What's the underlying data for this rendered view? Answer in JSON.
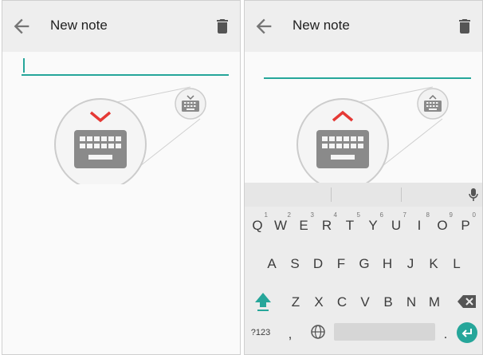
{
  "screens": [
    {
      "title": "New note",
      "keyboard_visible": false,
      "indicator": "chevron-down"
    },
    {
      "title": "New note",
      "keyboard_visible": true,
      "indicator": "chevron-up"
    }
  ],
  "keyboard": {
    "row1": [
      {
        "label": "Q",
        "hint": "1"
      },
      {
        "label": "W",
        "hint": "2"
      },
      {
        "label": "E",
        "hint": "3"
      },
      {
        "label": "R",
        "hint": "4"
      },
      {
        "label": "T",
        "hint": "5"
      },
      {
        "label": "Y",
        "hint": "6"
      },
      {
        "label": "U",
        "hint": "7"
      },
      {
        "label": "I",
        "hint": "8"
      },
      {
        "label": "O",
        "hint": "9"
      },
      {
        "label": "P",
        "hint": "0"
      }
    ],
    "row2": [
      "A",
      "S",
      "D",
      "F",
      "G",
      "H",
      "J",
      "K",
      "L"
    ],
    "row3": [
      "Z",
      "X",
      "C",
      "V",
      "B",
      "N",
      "M"
    ],
    "symbols_label": "?123",
    "comma_label": ",",
    "period_label": "."
  },
  "colors": {
    "accent": "#26a69a",
    "indicator_red": "#e53935",
    "icon_gray": "#757575"
  }
}
